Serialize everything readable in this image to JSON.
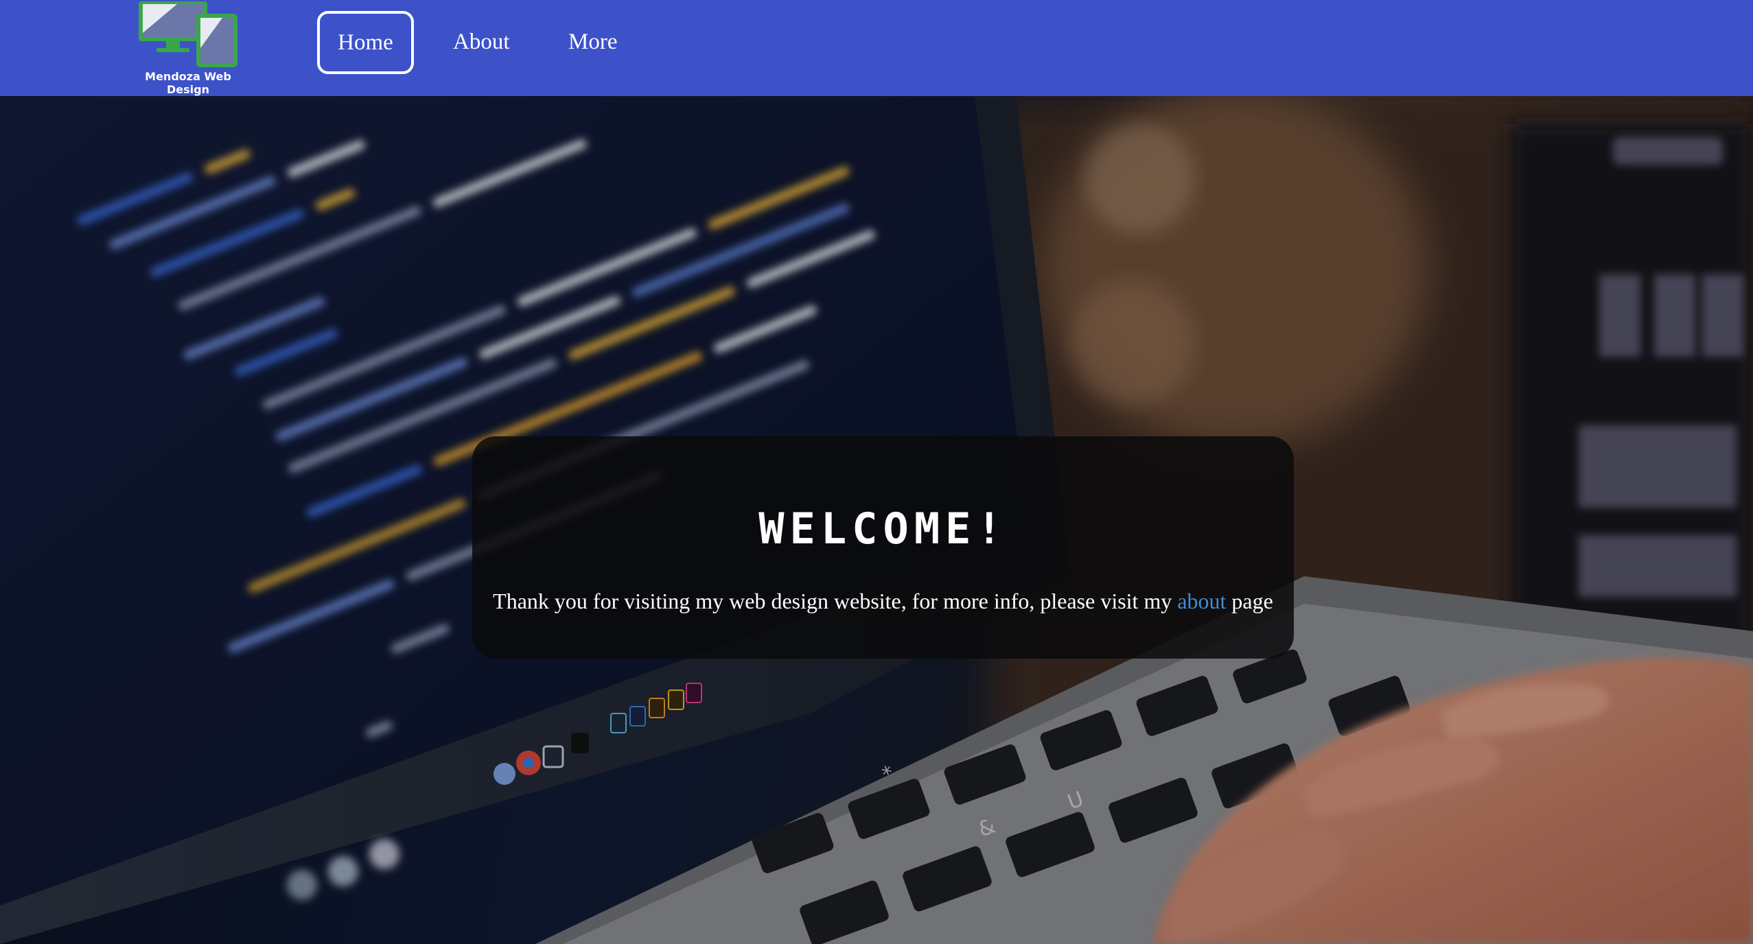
{
  "brand": {
    "logo_text": "Mendoza Web Design",
    "colors": {
      "navbar": "#3d52c9",
      "logo_green": "#3aa64a",
      "link": "#3d8ed8"
    }
  },
  "nav": {
    "items": [
      {
        "label": "Home",
        "active": true
      },
      {
        "label": "About",
        "active": false
      },
      {
        "label": "More",
        "active": false
      }
    ]
  },
  "hero": {
    "background": "photo-laptop-code-typing",
    "title": "WELCOME!",
    "text_before": "Thank you for visiting my web design website, for more info, please visit my ",
    "link_text": "about",
    "text_after": " page"
  }
}
